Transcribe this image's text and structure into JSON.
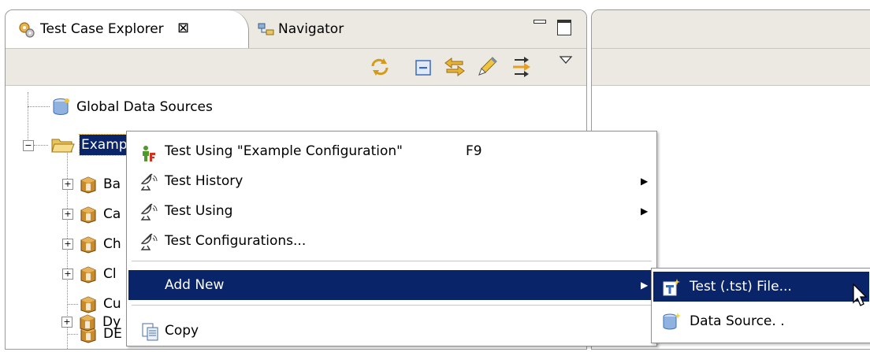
{
  "tabs": {
    "test_case_explorer": "Test Case Explorer",
    "navigator": "Navigator",
    "close_glyph": "⊠"
  },
  "tree": {
    "global_data_sources": "Global Data Sources",
    "example": "Examp",
    "children": [
      "Ba",
      "Ca",
      "Ch",
      "Cl",
      "Cu",
      "DE",
      "Dy"
    ]
  },
  "context_menu": {
    "test_using_example": "Test Using \"Example Configuration\"",
    "test_using_example_shortcut": "F9",
    "test_history": "Test History",
    "test_using": "Test Using",
    "test_configurations": "Test Configurations...",
    "add_new": "Add New",
    "copy": "Copy"
  },
  "submenu": {
    "test_file": "Test (.tst) File...",
    "data_source": "Data Source. ."
  },
  "colors": {
    "selection": "#0a246a",
    "panel_bg": "#ebe9e2"
  }
}
